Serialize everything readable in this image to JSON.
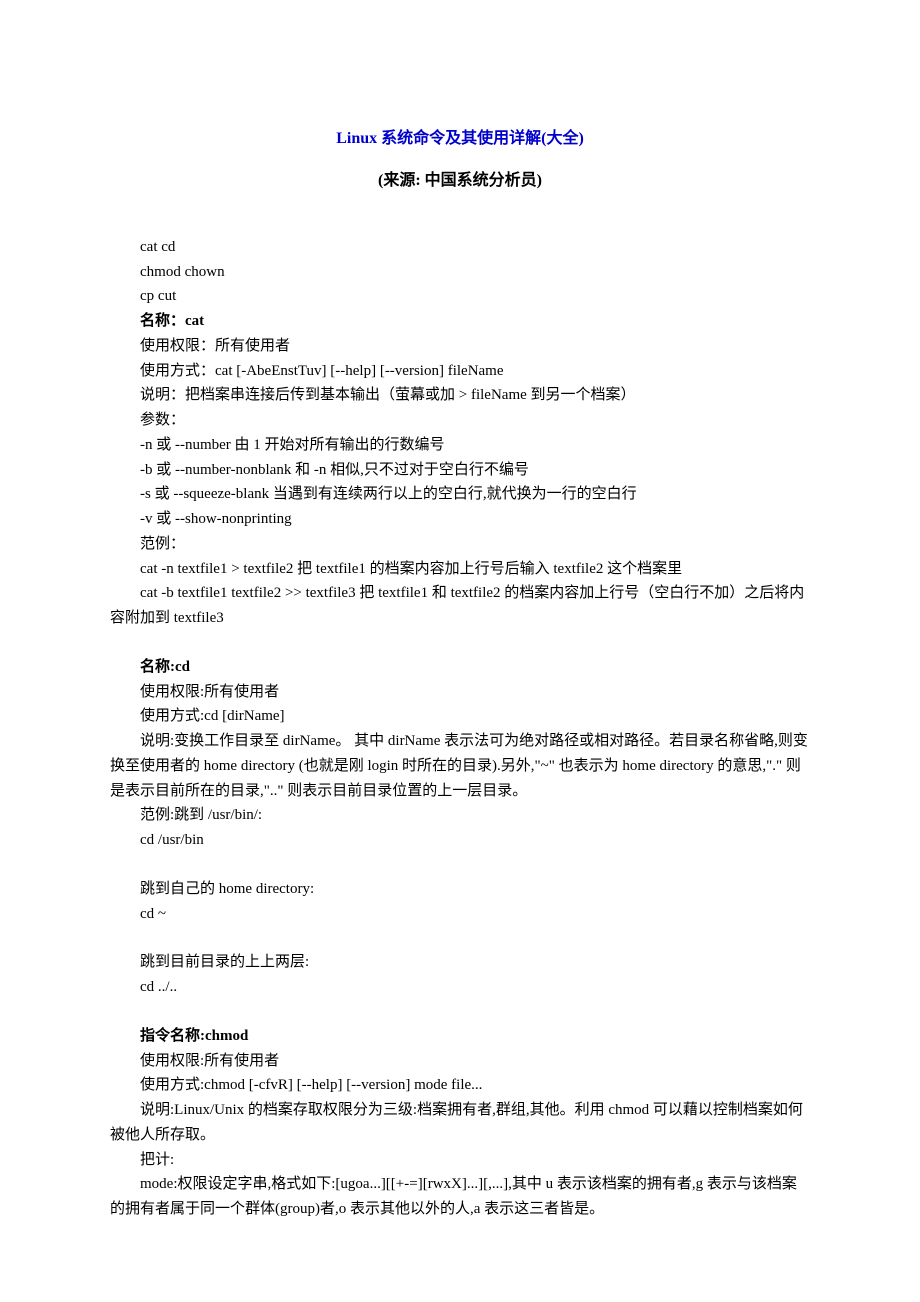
{
  "title": "Linux 系统命令及其使用详解(大全)",
  "subtitle": "(来源: 中国系统分析员)",
  "cmdlist": {
    "l1": "cat cd",
    "l2": "chmod chown",
    "l3": "cp cut"
  },
  "cat": {
    "heading": "名称：cat",
    "perm": "使用权限：所有使用者",
    "usage": "使用方式：cat [-AbeEnstTuv] [--help] [--version] fileName",
    "desc": "说明：把档案串连接后传到基本输出（萤幕或加 > fileName 到另一个档案）",
    "params_label": "参数：",
    "p1": "-n 或 --number 由 1 开始对所有输出的行数编号",
    "p2": "-b 或 --number-nonblank 和 -n 相似,只不过对于空白行不编号",
    "p3": "-s 或 --squeeze-blank 当遇到有连续两行以上的空白行,就代换为一行的空白行",
    "p4": "-v 或 --show-nonprinting",
    "examples_label": "范例：",
    "ex1": "cat -n textfile1 > textfile2 把 textfile1 的档案内容加上行号后输入 textfile2 这个档案里",
    "ex2": "cat -b textfile1 textfile2 >> textfile3 把 textfile1 和 textfile2 的档案内容加上行号（空白行不加）之后将内容附加到 textfile3"
  },
  "cd": {
    "heading": "名称:cd",
    "perm": "使用权限:所有使用者",
    "usage": "使用方式:cd [dirName]",
    "desc": "说明:变换工作目录至 dirName。 其中 dirName 表示法可为绝对路径或相对路径。若目录名称省略,则变换至使用者的 home directory (也就是刚 login 时所在的目录).另外,\"~\" 也表示为 home directory 的意思,\".\" 则是表示目前所在的目录,\"..\" 则表示目前目录位置的上一层目录。",
    "ex1_label": "范例:跳到 /usr/bin/:",
    "ex1_cmd": "cd /usr/bin",
    "ex2_label": "跳到自己的 home directory:",
    "ex2_cmd": "cd ~",
    "ex3_label": "跳到目前目录的上上两层:",
    "ex3_cmd": "cd ../.."
  },
  "chmod": {
    "heading": "指令名称:chmod",
    "perm": "使用权限:所有使用者",
    "usage": "使用方式:chmod [-cfvR] [--help] [--version] mode file...",
    "desc": "说明:Linux/Unix 的档案存取权限分为三级:档案拥有者,群组,其他。利用 chmod 可以藉以控制档案如何被他人所存取。",
    "count_label": "把计:",
    "mode": "mode:权限设定字串,格式如下:[ugoa...][[+-=][rwxX]...][,...],其中 u 表示该档案的拥有者,g 表示与该档案的拥有者属于同一个群体(group)者,o 表示其他以外的人,a 表示这三者皆是。"
  }
}
